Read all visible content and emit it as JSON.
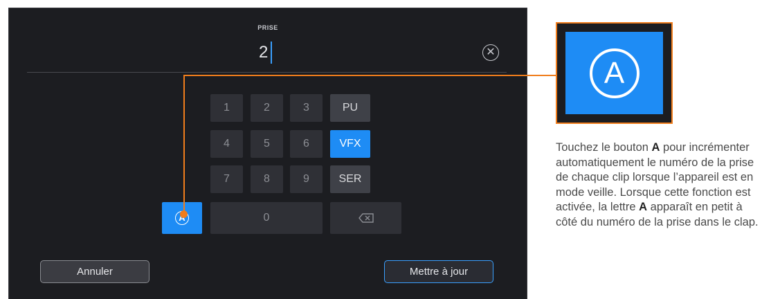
{
  "screen": {
    "field": {
      "label": "PRISE",
      "value": "2",
      "clear_icon": "close-circle-icon"
    },
    "keypad": {
      "digits": [
        "1",
        "2",
        "3",
        "4",
        "5",
        "6",
        "7",
        "8",
        "9",
        "0"
      ],
      "tags": [
        {
          "label": "PU",
          "active": false
        },
        {
          "label": "VFX",
          "active": true
        },
        {
          "label": "SER",
          "active": false
        }
      ],
      "auto_increment_label": "A",
      "backspace_icon": "backspace-icon"
    },
    "cancel_label": "Annuler",
    "update_label": "Mettre à jour"
  },
  "callout": {
    "icon_label": "A",
    "caption": {
      "p1": "Touchez le bouton ",
      "b1": "A",
      "p2": " pour incrémenter automatiquement le numéro de la prise de chaque clip lorsque l’appareil est en mode veille. Lorsque cette fonction est activée, la lettre ",
      "b2": "A",
      "p3": " apparaît en petit à côté du numéro de la prise dans le clap."
    }
  },
  "colors": {
    "accent": "#1e8cf5",
    "callout": "#f07d1c",
    "screen_bg": "#1c1d21"
  }
}
